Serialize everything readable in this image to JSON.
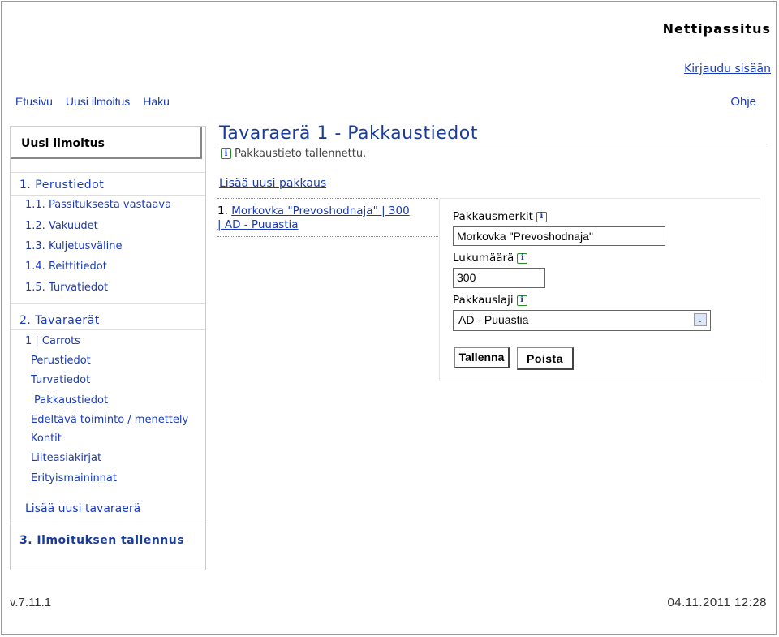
{
  "header": {
    "site_title": "Nettipassitus",
    "login_link": "Kirjaudu sisään",
    "nav": [
      "Etusivu",
      "Uusi ilmoitus",
      "Haku"
    ],
    "help": "Ohje"
  },
  "sidebar": {
    "heading": "Uusi ilmoitus",
    "section1": "1. Perustiedot",
    "section1_items": [
      "1.1. Passituksesta vastaava",
      "1.2. Vakuudet",
      "1.3. Kuljetusväline",
      "1.4. Reittitiedot",
      "1.5. Turvatiedot"
    ],
    "section2": "2. Tavaraerät",
    "item_title": "1 | Carrots",
    "item_subitems": [
      "Perustiedot",
      "Turvatiedot",
      "Pakkaustiedot",
      "Edeltävä toiminto / menettely",
      "Kontit",
      "Liiteasiakirjat",
      "Erityismaininnat"
    ],
    "add_item": "Lisää uusi tavaraerä",
    "section3": "3. Ilmoituksen tallennus"
  },
  "main": {
    "title": "Tavaraerä 1 - Pakkaustiedot",
    "saved_note": "Pakkaustieto tallennettu.",
    "add_package": "Lisää uusi pakkaus",
    "package_num": "1.",
    "package_line1": "Morkovka \"Prevoshodnaja\" | 300",
    "package_line2": "| AD - Puuastia"
  },
  "form": {
    "marks_label": "Pakkausmerkit",
    "marks_value": "Morkovka \"Prevoshodnaja\"",
    "qty_label": "Lukumäärä",
    "qty_value": "300",
    "type_label": "Pakkauslaji",
    "type_value": "AD - Puuastia",
    "save_btn": "Tallenna",
    "delete_btn": "Poista"
  },
  "footer": {
    "version": "v.7.11.1",
    "timestamp": "04.11.2011 12:28"
  },
  "icons": {
    "info": "info-icon",
    "select_arrow": "chevron-down-icon"
  },
  "colors": {
    "link": "#1a3bb4",
    "title": "#1a3b9a"
  }
}
